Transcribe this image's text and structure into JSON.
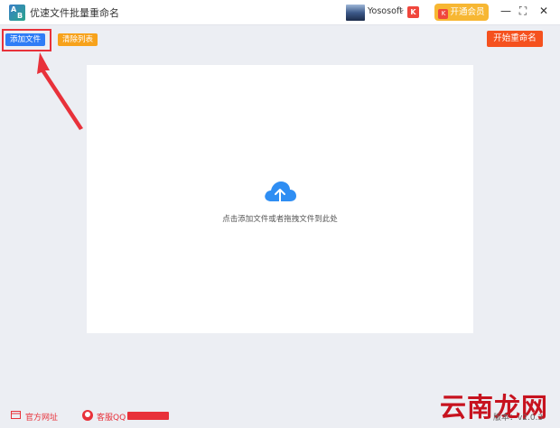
{
  "app": {
    "title": "优速文件批量重命名",
    "logo_text_a": "A",
    "logo_text_b": "B"
  },
  "user": {
    "name": "Yososoft",
    "vip_badge": "K"
  },
  "vip_button": {
    "label": "开通会员",
    "icon": "K"
  },
  "window_controls": {
    "minimize": "—",
    "maximize": "⛶",
    "close": "✕"
  },
  "toolbar": {
    "add_files": "添加文件",
    "clear_list": "清除列表",
    "start_rename": "开始重命名"
  },
  "drop_area": {
    "hint": "点击添加文件或者拖拽文件到此处",
    "icon": "cloud-upload-icon"
  },
  "footer": {
    "website": "官方网址",
    "support_qq": "客服QQ",
    "version_label": "版本：",
    "version": "v2.0.3",
    "watermark": "云南龙网"
  },
  "colors": {
    "primary": "#2f7df6",
    "orange": "#f7a21b",
    "start": "#f5511e",
    "vip": "#f7b733",
    "annotation": "#e8313a"
  }
}
